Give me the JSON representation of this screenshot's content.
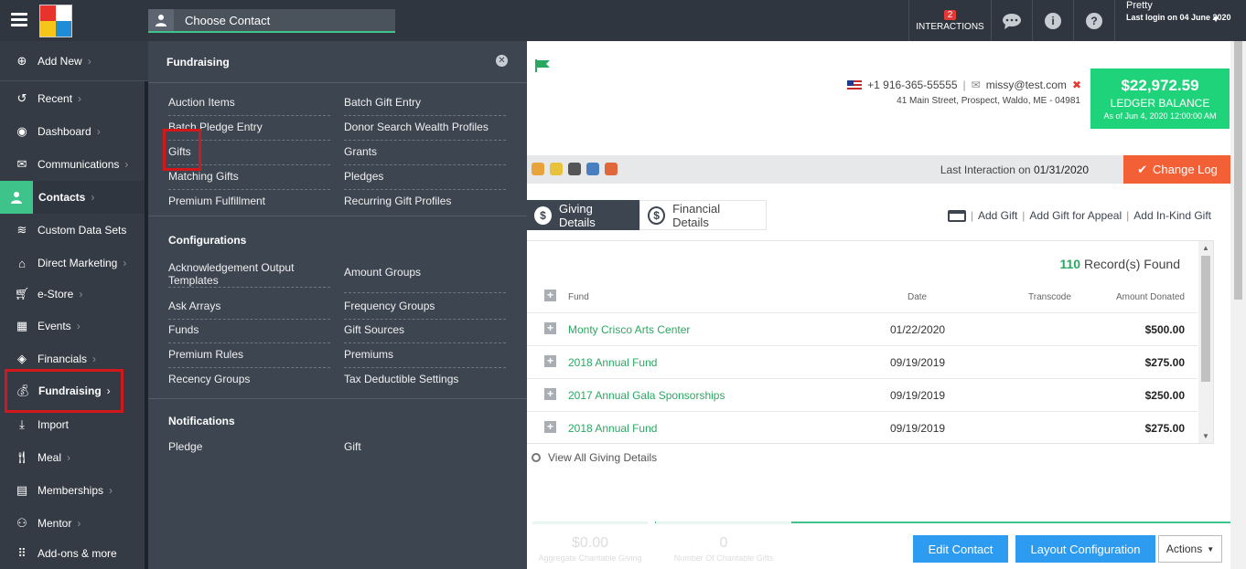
{
  "topbar": {
    "choose_contact": "Choose Contact",
    "interactions_count": "2",
    "interactions_label": "INTERACTIONS",
    "user_name": "Pretty",
    "last_login": "Last login on 04 June 2020"
  },
  "sidebar": {
    "items": [
      {
        "label": "Add New",
        "icon": "plus-circle-icon"
      },
      {
        "label": "Recent",
        "icon": "history-icon"
      },
      {
        "label": "Dashboard",
        "icon": "dashboard-icon"
      },
      {
        "label": "Communications",
        "icon": "envelope-icon"
      },
      {
        "label": "Contacts",
        "icon": "user-icon"
      },
      {
        "label": "Custom Data Sets",
        "icon": "database-icon"
      },
      {
        "label": "Direct Marketing",
        "icon": "home-icon"
      },
      {
        "label": "e-Store",
        "icon": "cart-icon"
      },
      {
        "label": "Events",
        "icon": "calendar-icon"
      },
      {
        "label": "Financials",
        "icon": "ticket-icon"
      },
      {
        "label": "Fundraising",
        "icon": "money-bag-icon"
      },
      {
        "label": "Import",
        "icon": "import-icon"
      },
      {
        "label": "Meal",
        "icon": "utensils-icon"
      },
      {
        "label": "Memberships",
        "icon": "id-card-icon"
      },
      {
        "label": "Mentor",
        "icon": "mentor-icon"
      },
      {
        "label": "Add-ons & more",
        "icon": "grid-icon"
      }
    ]
  },
  "dropdown": {
    "title": "Fundraising",
    "fundraising_left": [
      "Auction Items",
      "Batch Pledge Entry",
      "Gifts",
      "Matching Gifts",
      "Premium Fulfillment"
    ],
    "fundraising_right": [
      "Batch Gift Entry",
      "Donor Search Wealth Profiles",
      "Grants",
      "Pledges",
      "Recurring Gift Profiles"
    ],
    "config_title": "Configurations",
    "config_left": [
      "Acknowledgement Output Templates",
      "Ask Arrays",
      "Funds",
      "Premium Rules",
      "Recency Groups"
    ],
    "config_right": [
      "Amount Groups",
      "Frequency Groups",
      "Gift Sources",
      "Premiums",
      "Tax Deductible Settings"
    ],
    "notif_title": "Notifications",
    "notif_left": "Pledge",
    "notif_right": "Gift"
  },
  "contact": {
    "phone": "+1 916-365-55555",
    "email": "missy@test.com",
    "address": "41 Main Street, Prospect, Waldo, ME - 04981",
    "ledger_amount": "$22,972.59",
    "ledger_label": "LEDGER BALANCE",
    "ledger_asof": "As of Jun 4, 2020 12:00:00 AM",
    "last_interaction_label": "Last Interaction on",
    "last_interaction_date": "01/31/2020",
    "change_log": "Change Log"
  },
  "tabs": {
    "giving": "Giving Details",
    "financial": "Financial Details"
  },
  "gift_actions": {
    "add_gift": "Add Gift",
    "add_gift_appeal": "Add Gift for Appeal",
    "add_inkind": "Add In-Kind Gift"
  },
  "grid": {
    "records_count": "110",
    "records_label": "Record(s) Found",
    "headers": {
      "fund": "Fund",
      "date": "Date",
      "transcode": "Transcode",
      "amount": "Amount Donated"
    },
    "rows": [
      {
        "fund": "Monty Crisco Arts Center",
        "date": "01/22/2020",
        "amount": "$500.00"
      },
      {
        "fund": "2018 Annual Fund",
        "date": "09/19/2019",
        "amount": "$275.00"
      },
      {
        "fund": "2017 Annual Gala Sponsorships",
        "date": "09/19/2019",
        "amount": "$250.00"
      },
      {
        "fund": "2018 Annual Fund",
        "date": "09/19/2019",
        "amount": "$275.00"
      }
    ],
    "view_all": "View All Giving Details"
  },
  "stats": {
    "aggregate_value": "$0.00",
    "aggregate_label": "Aggregate Charitable Giving",
    "count_value": "0",
    "count_label": "Number Of Charitable Gifts"
  },
  "buttons": {
    "edit_contact": "Edit Contact",
    "layout_config": "Layout Configuration",
    "actions": "Actions"
  }
}
